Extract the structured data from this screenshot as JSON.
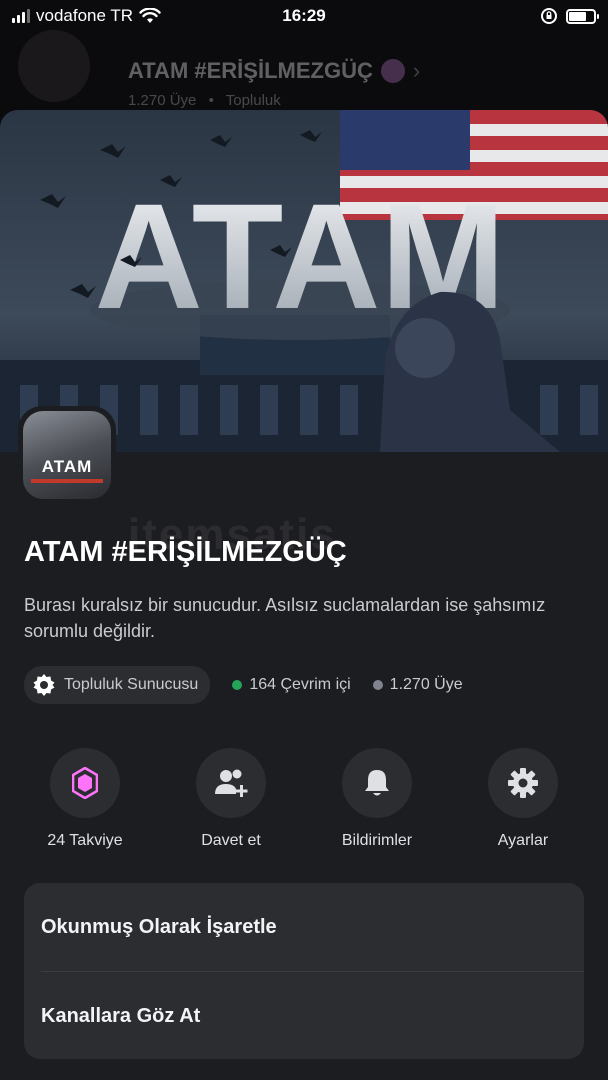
{
  "status_bar": {
    "carrier": "vodafone TR",
    "time": "16:29",
    "battery_level": 0.7
  },
  "background_header": {
    "title": "ATAM #ERİŞİLMEZGÜÇ",
    "members": "1.270 Üye",
    "type": "Topluluk"
  },
  "banner": {
    "text": "ATAM"
  },
  "server": {
    "icon_text": "ATAM",
    "name": "ATAM #ERİŞİLMEZGÜÇ",
    "description": "Burası kuralsız bir sunucudur. Asılsız suclamalardan ise şahsımız sorumlu değildir.",
    "community_label": "Topluluk Sunucusu",
    "online_count": "164 Çevrim içi",
    "member_count": "1.270 Üye"
  },
  "watermark": "itemsatis",
  "actions": [
    {
      "label": "24 Takviye",
      "icon": "boost-icon"
    },
    {
      "label": "Davet et",
      "icon": "invite-icon"
    },
    {
      "label": "Bildirimler",
      "icon": "bell-icon"
    },
    {
      "label": "Ayarlar",
      "icon": "gear-icon"
    }
  ],
  "menu": {
    "mark_read": "Okunmuş Olarak İşaretle",
    "browse_channels": "Kanallara Göz At"
  },
  "colors": {
    "sheet_bg": "#1c1d21",
    "card_bg": "#2b2d31",
    "online": "#23a55a",
    "offline": "#80848e",
    "boost": "#ff73fa"
  }
}
